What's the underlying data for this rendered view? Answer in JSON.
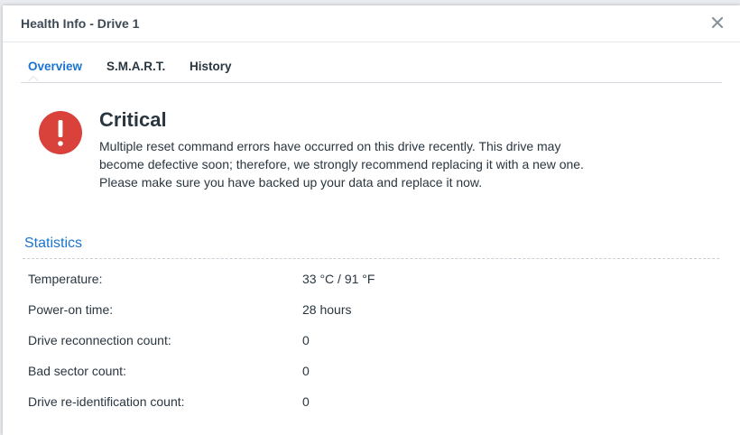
{
  "dialog": {
    "title": "Health Info - Drive 1",
    "close_icon": "close-icon"
  },
  "tabs": [
    {
      "label": "Overview",
      "active": true
    },
    {
      "label": "S.M.A.R.T.",
      "active": false
    },
    {
      "label": "History",
      "active": false
    }
  ],
  "status": {
    "icon": "alert-exclamation-icon",
    "icon_color": "#d9413b",
    "title": "Critical",
    "description_1": "Multiple reset command errors have occurred on this drive recently. This drive may become defective soon; therefore, we strongly recommend replacing it with a new one.",
    "description_2": "Please make sure you have backed up your data and replace it now."
  },
  "statistics": {
    "title": "Statistics",
    "rows": [
      {
        "label": "Temperature:",
        "value": "33 °C / 91 °F"
      },
      {
        "label": "Power-on time:",
        "value": "28 hours"
      },
      {
        "label": "Drive reconnection count:",
        "value": "0"
      },
      {
        "label": "Bad sector count:",
        "value": "0"
      },
      {
        "label": "Drive re-identification count:",
        "value": "0"
      }
    ]
  },
  "colors": {
    "accent": "#1a74d0",
    "critical": "#d9413b",
    "text": "#2a3640"
  }
}
